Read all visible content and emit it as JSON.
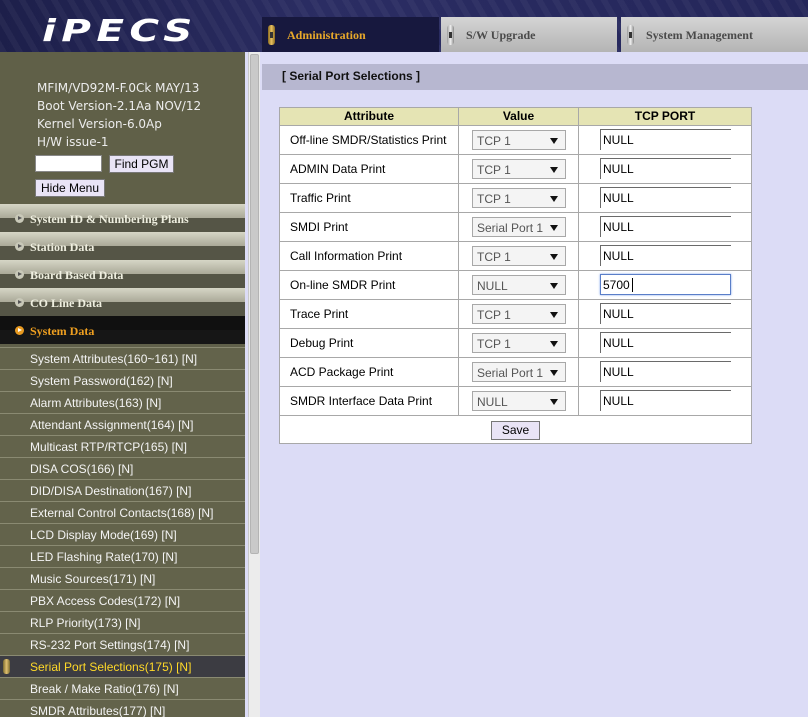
{
  "header": {
    "logo": "iPECS",
    "tabs": [
      {
        "label": "Administration",
        "active": true
      },
      {
        "label": "S/W Upgrade",
        "active": false
      },
      {
        "label": "System Management",
        "active": false
      }
    ]
  },
  "sidebar": {
    "info": [
      "MFIM/VD92M-F.0Ck MAY/13",
      "Boot Version-2.1Aa NOV/12",
      "Kernel Version-6.0Ap",
      "H/W issue-1"
    ],
    "pgm_input_value": "",
    "find_pgm_label": "Find PGM",
    "hide_menu_label": "Hide Menu",
    "categories": [
      "System ID & Numbering Plans",
      "Station Data",
      "Board Based Data",
      "CO Line Data",
      "System Data"
    ],
    "active_category": "System Data",
    "items": [
      "System Attributes(160~161) [N]",
      "System Password(162) [N]",
      "Alarm Attributes(163) [N]",
      "Attendant Assignment(164) [N]",
      "Multicast RTP/RTCP(165) [N]",
      "DISA COS(166) [N]",
      "DID/DISA Destination(167) [N]",
      "External Control Contacts(168) [N]",
      "LCD Display Mode(169) [N]",
      "LED Flashing Rate(170) [N]",
      "Music Sources(171) [N]",
      "PBX Access Codes(172) [N]",
      "RLP Priority(173) [N]",
      "RS-232 Port Settings(174) [N]",
      "Serial Port Selections(175) [N]",
      "Break / Make Ratio(176) [N]",
      "SMDR Attributes(177) [N]"
    ],
    "active_item": "Serial Port Selections(175) [N]"
  },
  "main": {
    "title": "[ Serial Port Selections ]",
    "columns": [
      "Attribute",
      "Value",
      "TCP PORT"
    ],
    "rows": [
      {
        "attribute": "Off-line SMDR/Statistics Print",
        "value": "TCP 1",
        "tcp_port": "NULL"
      },
      {
        "attribute": "ADMIN Data Print",
        "value": "TCP 1",
        "tcp_port": "NULL"
      },
      {
        "attribute": "Traffic Print",
        "value": "TCP 1",
        "tcp_port": "NULL"
      },
      {
        "attribute": "SMDI Print",
        "value": "Serial Port 1",
        "tcp_port": "NULL"
      },
      {
        "attribute": "Call Information Print",
        "value": "TCP 1",
        "tcp_port": "NULL"
      },
      {
        "attribute": "On-line SMDR Print",
        "value": "NULL",
        "tcp_port": "5700"
      },
      {
        "attribute": "Trace Print",
        "value": "TCP 1",
        "tcp_port": "NULL"
      },
      {
        "attribute": "Debug Print",
        "value": "TCP 1",
        "tcp_port": "NULL"
      },
      {
        "attribute": "ACD Package Print",
        "value": "Serial Port 1",
        "tcp_port": "NULL"
      },
      {
        "attribute": "SMDR Interface Data Print",
        "value": "NULL",
        "tcp_port": "NULL"
      }
    ],
    "save_label": "Save"
  },
  "colors": {
    "accent_orange": "#e8a82a",
    "active_item_text": "#ffd928",
    "table_header_bg": "#e5e4b4",
    "content_bg": "#dcdcf6"
  }
}
